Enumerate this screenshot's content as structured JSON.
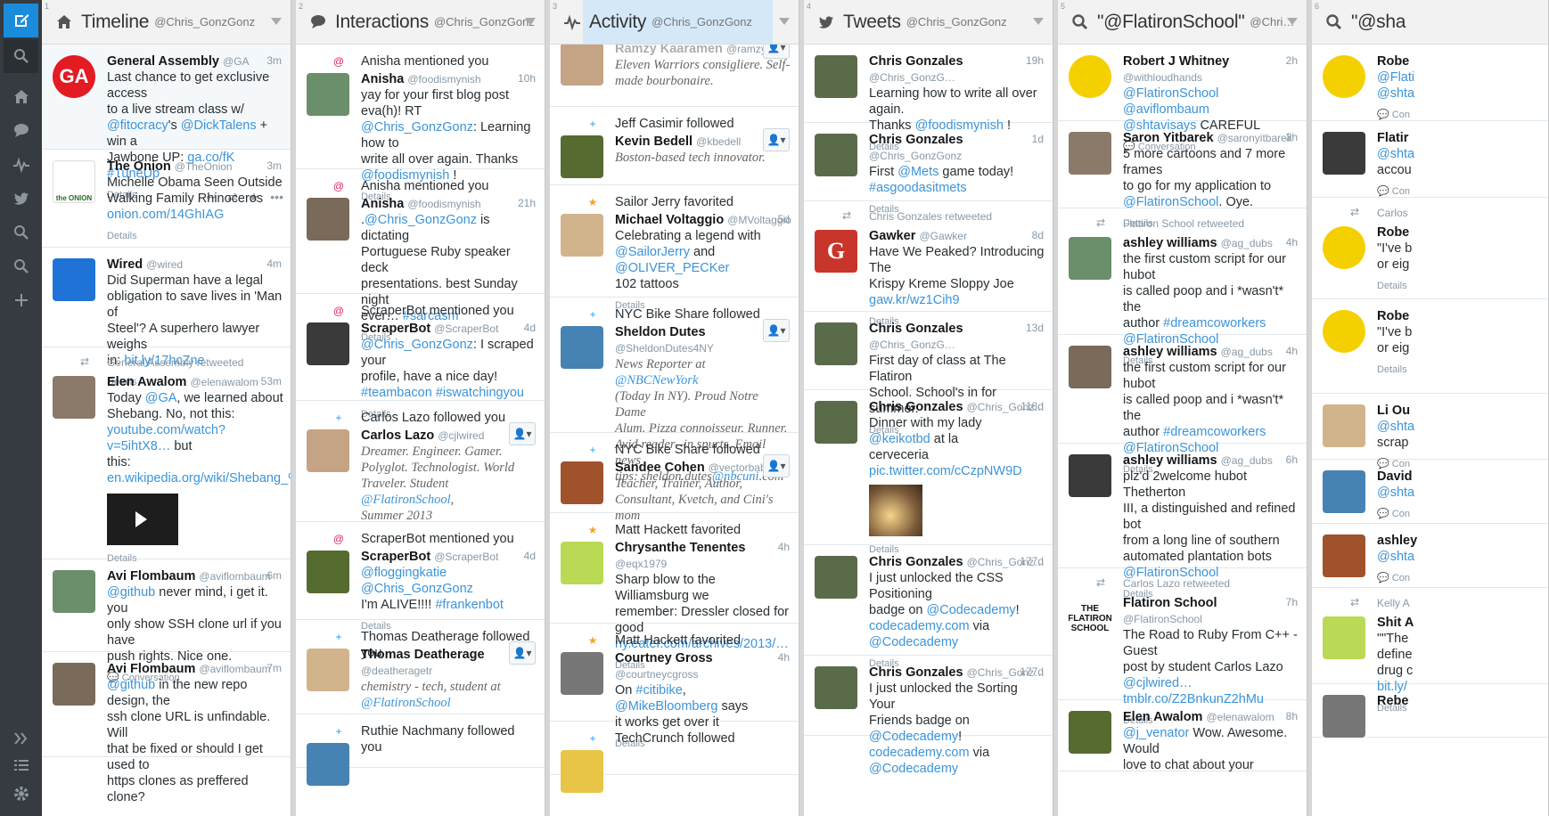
{
  "nav": {
    "items": [
      "compose-icon",
      "search-icon",
      "home-icon",
      "interactions-icon",
      "activity-icon",
      "twitter-icon",
      "search-column-icon",
      "search-column-icon-2",
      "add-column-icon"
    ],
    "bottom": [
      "expand-icon",
      "lists-icon",
      "settings-icon"
    ]
  },
  "columns": [
    {
      "num": "1",
      "icon": "home-icon",
      "title": "Timeline",
      "handle": "@Chris_GonzGonz"
    },
    {
      "num": "2",
      "icon": "interactions-icon",
      "title": "Interactions",
      "handle": "@Chris_GonzGonz"
    },
    {
      "num": "3",
      "icon": "activity-icon",
      "title": "Activity",
      "handle": "@Chris_GonzGonz"
    },
    {
      "num": "4",
      "icon": "twitter-icon",
      "title": "Tweets",
      "handle": "@Chris_GonzGonz"
    },
    {
      "num": "5",
      "icon": "search-icon",
      "title": "\"@FlatironSchool\"",
      "handle": "@Chri…"
    },
    {
      "num": "6",
      "icon": "search-icon",
      "title": "\"@sha",
      "handle": ""
    }
  ],
  "timeline": [
    {
      "name": "General Assembly",
      "handle": "@GA",
      "time": "3m",
      "text": [
        "Last chance to get exclusive access",
        "to a live stream class w/",
        "@fitocracy's @DickTalens + win a",
        "Jawbone UP: ga.co/fK #TuneUp"
      ],
      "details": "Details"
    },
    {
      "name": "The Onion",
      "handle": "@TheOnion",
      "time": "3m",
      "text": [
        "Michelle Obama Seen Outside",
        "Walking Family Rhinoceros",
        "onion.com/14GhIAG"
      ],
      "details": "Details"
    },
    {
      "name": "Wired",
      "handle": "@wired",
      "time": "4m",
      "text": [
        "Did Superman have a legal",
        "obligation to save lives in 'Man of",
        "Steel'? A superhero lawyer weighs",
        "in: bit.ly/17hcZne"
      ],
      "details": "Details"
    },
    {
      "rt": "General Assembly retweeted",
      "name": "Elen Awalom",
      "handle": "@elenawalom",
      "time": "53m",
      "text": [
        "Today @GA, we learned about",
        "Shebang. No, not this:",
        "youtube.com/watch?v=5ihtX8… but",
        "this:",
        "en.wikipedia.org/wiki/Shebang_%…"
      ],
      "details": "Details"
    },
    {
      "name": "Avi Flombaum",
      "handle": "@aviflombaum",
      "time": "6m",
      "text": [
        "@github  never mind, i get it. you",
        "only show SSH clone url if you have",
        "push rights. Nice one."
      ],
      "details": "Conversation"
    },
    {
      "name": "Avi Flombaum",
      "handle": "@aviflombaum",
      "time": "7m",
      "text": [
        "@github in the new repo design, the",
        "ssh clone URL is unfindable. Will",
        "that be fixed or should I get used to",
        "https clones as preffered clone?"
      ],
      "details": ""
    }
  ],
  "interactions": [
    {
      "action": "Anisha mentioned you",
      "name": "Anisha",
      "handle": "@foodismynish",
      "time": "10h",
      "text": [
        "yay for your first blog post eva(h)! RT",
        "@Chris_GonzGonz: Learning how to",
        "write all over again. Thanks",
        "@foodismynish !"
      ],
      "details": "Details"
    },
    {
      "action": "Anisha mentioned you",
      "name": "Anisha",
      "handle": "@foodismynish",
      "time": "21h",
      "text": [
        ".@Chris_GonzGonz is dictating",
        "Portuguese Ruby speaker deck",
        "presentations. best Sunday night",
        "ever… #sarcasm"
      ],
      "details": "Details"
    },
    {
      "action": "ScraperBot mentioned you",
      "name": "ScraperBot",
      "handle": "@ScraperBot",
      "time": "4d",
      "text": [
        "@Chris_GonzGonz: I scraped your",
        "profile, have a nice day!",
        "#teambacon #iswatchingyou"
      ],
      "details": "Details"
    },
    {
      "action": "Carlos Lazo followed you",
      "name": "Carlos Lazo",
      "handle": "@cjlwired",
      "time": "",
      "bio": [
        "Dreamer. Engineer. Gamer.",
        "Polyglot. Technologist. World",
        "Traveler. Student @FlatironSchool,",
        "Summer 2013"
      ]
    },
    {
      "action": "ScraperBot mentioned you",
      "name": "ScraperBot",
      "handle": "@ScraperBot",
      "time": "4d",
      "text": [
        "@floggingkatie @Chris_GonzGonz",
        "I'm ALIVE!!!! #frankenbot"
      ],
      "details": "Details"
    },
    {
      "action": "Thomas Deatherage followed you",
      "name": "Thomas Deatherage",
      "handle": "@deatheragetr",
      "time": "",
      "bio": [
        "chemistry - tech, student at",
        "@FlatironSchool"
      ]
    },
    {
      "action": "Ruthie Nachmany followed you"
    }
  ],
  "activity": [
    {
      "partial": "Ramzy Kaaramen",
      "handle": "@ramzy",
      "bio": [
        "Eleven Warriors consigliere. Self-",
        "made bourbonaire."
      ]
    },
    {
      "action": "Jeff Casimir followed",
      "name": "Kevin Bedell",
      "handle": "@kbedell",
      "bio": [
        "Boston-based tech innovator."
      ]
    },
    {
      "action": "Sailor Jerry favorited",
      "name": "Michael Voltaggio",
      "handle": "@MVoltaggio",
      "time": "5d",
      "text": [
        "Celebrating a legend with",
        "@SailorJerry and @OLIVER_PECKer",
        "102 tattoos"
      ],
      "details": "Details"
    },
    {
      "action": "NYC Bike Share followed",
      "name": "Sheldon Dutes",
      "handle": "@SheldonDutes4NY",
      "bio": [
        "News Reporter at @NBCNewYork",
        "(Today In NY). Proud Notre Dame",
        "Alum. Pizza connoisseur. Runner.",
        "Avid reader--in spurts. Email news",
        "tips: sheldon.dutes@nbcuni.com"
      ]
    },
    {
      "action": "NYC Bike Share followed",
      "name": "Sandee Cohen",
      "handle": "@vectorbabe",
      "bio": [
        "Teacher, Trainer, Author,",
        "Consultant, Kvetch, and Cini's mom"
      ]
    },
    {
      "action": "Matt Hackett favorited",
      "name": "Chrysanthe Tenentes",
      "handle": "@eqx1979",
      "time": "4h",
      "text": [
        "Sharp blow to the Williamsburg we",
        "remember: Dressler closed for good",
        "ny.eater.com/archives/2013/…"
      ],
      "details": "Details"
    },
    {
      "action": "Matt Hackett favorited",
      "name": "Courtney Gross",
      "handle": "@courtneycgross",
      "time": "4h",
      "text": [
        "On #citibike, @MikeBloomberg says",
        "it works get over it"
      ],
      "details": "Details"
    },
    {
      "action": "TechCrunch followed"
    }
  ],
  "tweets": [
    {
      "name": "Chris Gonzales",
      "handle": "@Chris_GonzG…",
      "time": "19h",
      "text": [
        "Learning how to write all over again.",
        "Thanks @foodismynish !"
      ],
      "details": "Details"
    },
    {
      "name": "Chris Gonzales",
      "handle": "@Chris_GonzGonz",
      "time": "1d",
      "text": [
        "First @Mets game today!",
        "#asgoodasitmets"
      ],
      "details": "Details"
    },
    {
      "rt": "Chris Gonzales retweeted",
      "name": "Gawker",
      "handle": "@Gawker",
      "time": "8d",
      "text": [
        "Have We Peaked? Introducing The",
        "Krispy Kreme Sloppy Joe",
        "gaw.kr/wz1Cih9"
      ],
      "details": "Details"
    },
    {
      "name": "Chris Gonzales",
      "handle": "@Chris_GonzG…",
      "time": "13d",
      "text": [
        "First day of class at The Flatiron",
        "School. School's in for summer."
      ],
      "details": "Details"
    },
    {
      "name": "Chris Gonzales",
      "handle": "@Chris_Gonz…",
      "time": "118d",
      "text": [
        "Dinner with my lady @keikotbd at la",
        "cerveceria",
        "pic.twitter.com/cCzpNW9D"
      ],
      "details": "Details"
    },
    {
      "name": "Chris Gonzales",
      "handle": "@Chris_Gonz…",
      "time": "177d",
      "text": [
        "I just unlocked the CSS Positioning",
        "badge on @Codecademy!",
        "codecademy.com via",
        "@Codecademy"
      ],
      "details": "Details"
    },
    {
      "name": "Chris Gonzales",
      "handle": "@Chris_Gonz…",
      "time": "177d",
      "text": [
        "I just unlocked the Sorting Your",
        "Friends badge on @Codecademy!",
        "codecademy.com via",
        "@Codecademy"
      ],
      "details": ""
    }
  ],
  "flatiron": [
    {
      "name": "Robert J Whitney",
      "handle": "@withloudhands",
      "time": "2h",
      "text": [
        "@FlatironSchool @aviflombaum",
        "@shtavisays CAREFUL"
      ],
      "details": "Conversation"
    },
    {
      "name": "Saron Yitbarek",
      "handle": "@saronyitbarek",
      "time": "3h",
      "text": [
        "5 more cartoons and 7 more frames",
        "to go for my application to",
        "@FlatironSchool. Oye."
      ],
      "details": "Details"
    },
    {
      "rt": "Flatiron School retweeted",
      "name": "ashley williams",
      "handle": "@ag_dubs",
      "time": "4h",
      "text": [
        "the first custom script for our hubot",
        "is called poop and i *wasn't* the",
        "author #dreamcoworkers",
        "@FlatironSchool"
      ],
      "details": "Details"
    },
    {
      "name": "ashley williams",
      "handle": "@ag_dubs",
      "time": "4h",
      "text": [
        "the first custom script for our hubot",
        "is called poop and i *wasn't* the",
        "author #dreamcoworkers",
        "@FlatironSchool"
      ],
      "details": "Details"
    },
    {
      "name": "ashley williams",
      "handle": "@ag_dubs",
      "time": "6h",
      "text": [
        "plz'd 2welcome hubot Thetherton",
        "III, a distinguished and refined bot",
        "from a long line of southern",
        "automated plantation bots",
        "@FlatironSchool"
      ],
      "details": "Details"
    },
    {
      "rt": "Carlos Lazo retweeted",
      "name": "Flatiron School",
      "handle": "@FlatironSchool",
      "time": "7h",
      "text": [
        "The Road to Ruby From C++ - Guest",
        "post by student Carlos Lazo",
        "@cjlwired…",
        "tmblr.co/Z2BnkunZ2hMu"
      ],
      "details": "Details"
    },
    {
      "name": "Elen Awalom",
      "handle": "@elenawalom",
      "time": "8h",
      "text": [
        "@j_venator Wow. Awesome. Would",
        "love to chat about your"
      ],
      "details": ""
    }
  ],
  "col6": [
    {
      "name": "Robe",
      "text": [
        "@Flati",
        "@shta"
      ],
      "details": "Con"
    },
    {
      "name": "Flatir",
      "text": [
        "@shta",
        "accou"
      ],
      "details": "Con"
    },
    {
      "rt": "Carlos",
      "name": "Robe",
      "text": [
        "\"I've b",
        "or eig"
      ],
      "details": "Details"
    },
    {
      "name": "Robe",
      "text": [
        "\"I've b",
        "or eig"
      ],
      "details": "Details"
    },
    {
      "name": "Li Ou",
      "text": [
        "@shta",
        "scrap"
      ],
      "details": "Con"
    },
    {
      "name": "David",
      "text": [
        "@shta"
      ],
      "details": "Con"
    },
    {
      "name": "ashley",
      "text": [
        "@shta"
      ],
      "details": "Con"
    },
    {
      "rt": "Kelly A",
      "name": "Shit A",
      "text": [
        "\"\"The",
        "define",
        "drug c",
        "bit.ly/"
      ],
      "details": "Details"
    },
    {
      "name": "Rebe",
      "text": [],
      "details": ""
    }
  ],
  "colors": {
    "accent": "#1b8cdb",
    "link": "#3b94d9",
    "navbar": "#353b40",
    "bg": "#ffffff"
  }
}
